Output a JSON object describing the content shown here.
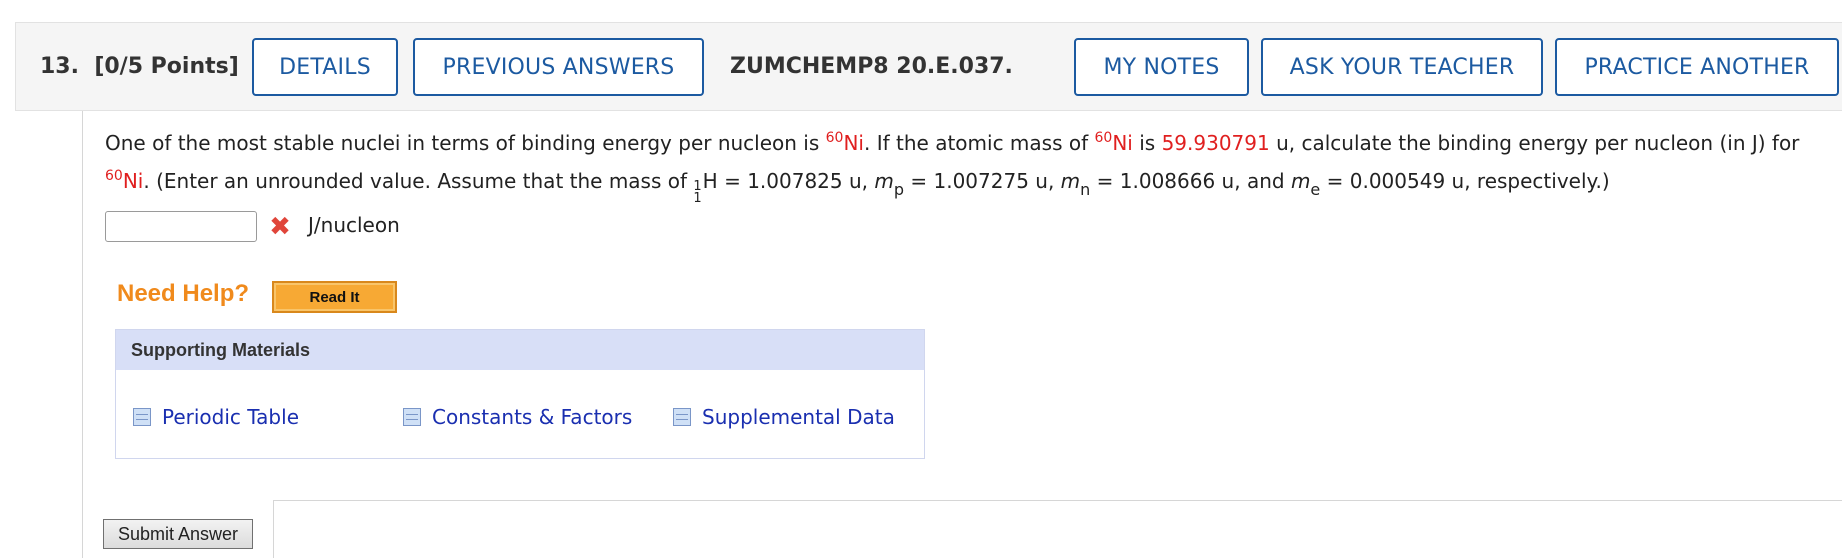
{
  "header": {
    "question_number": "13.",
    "points": "[0/5 Points]",
    "details_label": "DETAILS",
    "previous_answers_label": "PREVIOUS ANSWERS",
    "code": "ZUMCHEMP8 20.E.037.",
    "my_notes_label": "MY NOTES",
    "ask_teacher_label": "ASK YOUR TEACHER",
    "practice_another_label": "PRACTICE ANOTHER"
  },
  "question": {
    "t1": "One of the most stable nuclei in terms of binding energy per nucleon is ",
    "iso_mass": "60",
    "element": "Ni",
    "t2": ". If the atomic mass of ",
    "t3": " is ",
    "atomic_mass": "59.930791",
    "t4": " u, calculate the binding energy per nucleon (in J) for",
    "t5": ". (Enter an unrounded value. Assume that the mass of ",
    "h_mass_number": "1",
    "h_atomic_number": "1",
    "h_symbol": "H",
    "t6": " = 1.007825 u, ",
    "m": "m",
    "sub_p": "p",
    "t7": " = 1.007275 u, ",
    "sub_n": "n",
    "t8": " = 1.008666 u, and ",
    "sub_e": "e",
    "t9": " = 0.000549 u, respectively.)"
  },
  "answer": {
    "value": "",
    "status_icon": "x-mark-icon",
    "unit": "J/nucleon"
  },
  "help": {
    "need_help": "Need Help?",
    "read_it": "Read It"
  },
  "supporting": {
    "title": "Supporting Materials",
    "links": [
      "Periodic Table",
      "Constants & Factors",
      "Supplemental Data"
    ]
  },
  "submit_label": "Submit Answer",
  "colors": {
    "accent": "#1c5aa1",
    "highlight": "#e01f1f",
    "help_orange": "#f08a1c",
    "link": "#1a2fb0"
  }
}
